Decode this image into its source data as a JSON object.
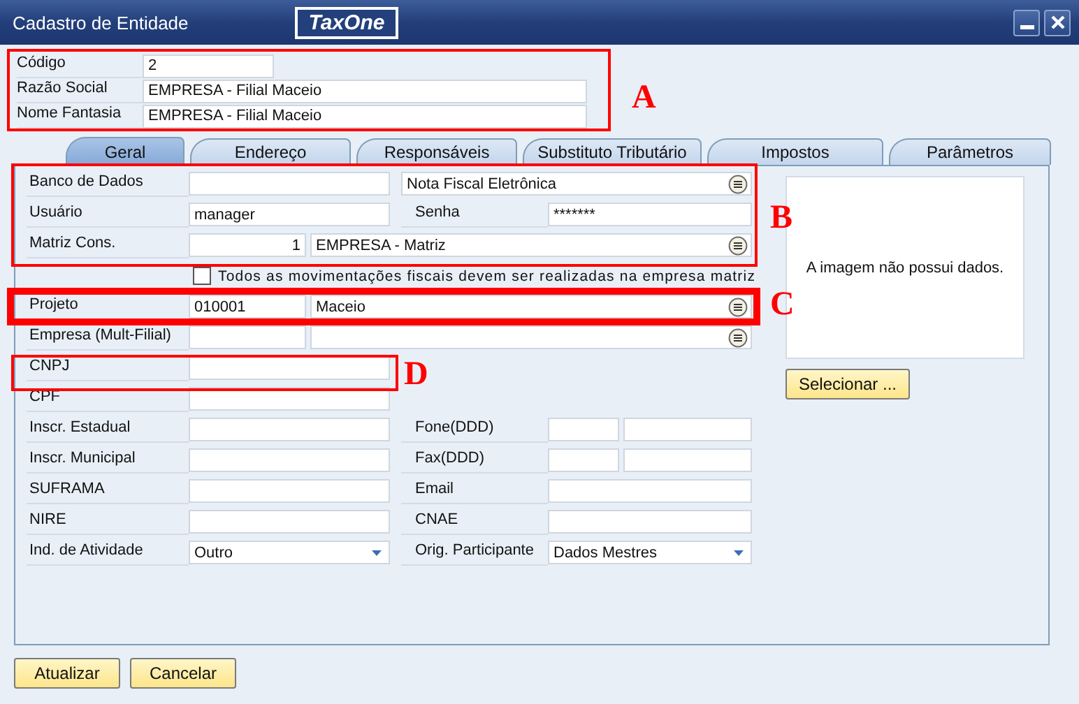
{
  "window": {
    "title": "Cadastro de Entidade",
    "logo": "TaxOne"
  },
  "header_fields": [
    {
      "label": "Código",
      "value": "2",
      "kind": "short"
    },
    {
      "label": "Razão Social",
      "value": "EMPRESA - Filial Maceio",
      "kind": "long"
    },
    {
      "label": "Nome Fantasia",
      "value": "EMPRESA - Filial Maceio",
      "kind": "long"
    }
  ],
  "tabs": [
    {
      "label": "Geral",
      "selected": true
    },
    {
      "label": "Endereço",
      "selected": false
    },
    {
      "label": "Responsáveis",
      "selected": false
    },
    {
      "label": "Substituto Tributário",
      "selected": false
    },
    {
      "label": "Impostos",
      "selected": false
    },
    {
      "label": "Parâmetros",
      "selected": false
    }
  ],
  "form": {
    "rows": [
      {
        "kind": "lookup",
        "label": "Banco de Dados",
        "name": "Nota Fiscal Eletrônica"
      },
      {
        "kind": "login",
        "label": "Usuário",
        "value": "manager",
        "right": {
          "label": "Senha",
          "value": "*******"
        }
      },
      {
        "kind": "code",
        "label": "Matriz Cons.",
        "code": "1",
        "align_right": true,
        "name": "EMPRESA - Matriz"
      },
      {
        "kind": "checkbox",
        "text": "Todos as movimentações fiscais devem ser realizadas na empresa matriz",
        "checked": false
      },
      {
        "kind": "code",
        "label": "Projeto",
        "code": "010001",
        "align_right": false,
        "name": "Maceio"
      },
      {
        "kind": "code",
        "label": "Empresa (Mult-Filial)"
      },
      {
        "kind": "text",
        "label": "CNPJ"
      },
      {
        "kind": "text",
        "label": "CPF"
      },
      {
        "kind": "text",
        "label": "Inscr. Estadual",
        "right": {
          "label": "Fone(DDD)",
          "kind": "split"
        }
      },
      {
        "kind": "text",
        "label": "Inscr. Municipal",
        "right": {
          "label": "Fax(DDD)",
          "kind": "split"
        }
      },
      {
        "kind": "text",
        "label": "SUFRAMA",
        "right": {
          "label": "Email",
          "kind": "text"
        }
      },
      {
        "kind": "text",
        "label": "NIRE",
        "right": {
          "label": "CNAE",
          "kind": "text"
        }
      },
      {
        "kind": "select",
        "label": "Ind. de Atividade",
        "value": "Outro",
        "right": {
          "label": "Orig. Participante",
          "kind": "select",
          "value": "Dados Mestres"
        }
      }
    ]
  },
  "image_panel": {
    "message": "A imagem não possui dados.",
    "button": "Selecionar ..."
  },
  "buttons": [
    "Atualizar",
    "Cancelar"
  ],
  "annotations": [
    {
      "letter": "A"
    },
    {
      "letter": "B"
    },
    {
      "letter": "C"
    },
    {
      "letter": "D"
    }
  ]
}
